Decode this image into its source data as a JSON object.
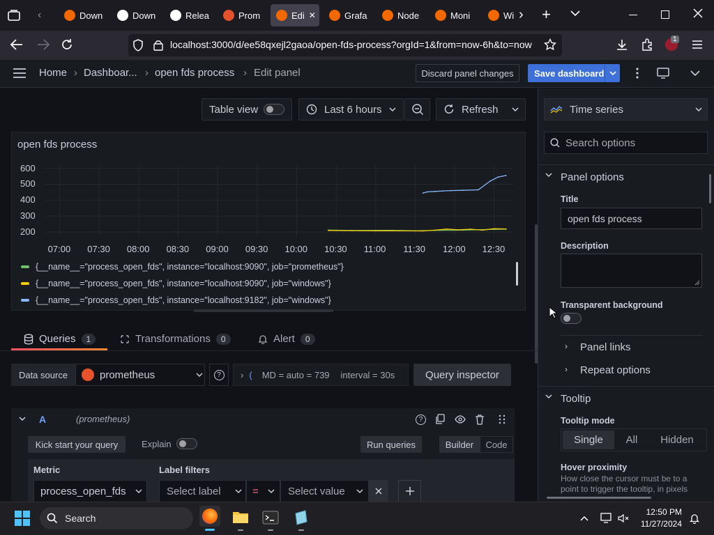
{
  "browser": {
    "tabs": [
      {
        "label": "Down",
        "icon": "grafana-icon"
      },
      {
        "label": "Down",
        "icon": "grafana-white-icon"
      },
      {
        "label": "Relea",
        "icon": "github-icon"
      },
      {
        "label": "Prom",
        "icon": "prometheus-icon"
      },
      {
        "label": "Edi",
        "icon": "grafana-icon",
        "active": true
      },
      {
        "label": "Grafa",
        "icon": "grafana-icon"
      },
      {
        "label": "Node",
        "icon": "grafana-icon"
      },
      {
        "label": "Moni",
        "icon": "grafana-icon"
      },
      {
        "label": "Wi",
        "icon": "grafana-icon"
      }
    ],
    "url": "localhost:3000/d/ee58qxejl2gaoa/open-fds-process?orgId=1&from=now-6h&to=now",
    "extension_badge": "1"
  },
  "header": {
    "breadcrumbs": [
      "Home",
      "Dashboar...",
      "open fds process",
      "Edit panel"
    ],
    "discard_label": "Discard panel changes",
    "save_label": "Save dashboard"
  },
  "toolbar": {
    "table_view_label": "Table view",
    "time_range_label": "Last 6 hours",
    "refresh_label": "Refresh"
  },
  "panel": {
    "title": "open fds process"
  },
  "chart_data": {
    "type": "line",
    "title": "open fds process",
    "xlabel": "",
    "ylabel": "",
    "x_ticks": [
      "07:00",
      "07:30",
      "08:00",
      "08:30",
      "09:00",
      "09:30",
      "10:00",
      "10:30",
      "11:00",
      "11:30",
      "12:00",
      "12:30"
    ],
    "y_ticks": [
      600,
      500,
      400,
      300,
      200
    ],
    "ylim": [
      170,
      620
    ],
    "grid": true,
    "legend_placement": "bottom",
    "series": [
      {
        "name": "{__name__=\"process_open_fds\", instance=\"localhost:9090\", job=\"prometheus\"}",
        "color": "#73bf69",
        "points": [
          [
            10.4,
            212
          ],
          [
            10.8,
            210
          ],
          [
            11.2,
            211
          ],
          [
            11.5,
            208
          ],
          [
            11.8,
            211
          ],
          [
            12.1,
            212
          ],
          [
            12.4,
            216
          ],
          [
            12.65,
            218
          ]
        ]
      },
      {
        "name": "{__name__=\"process_open_fds\", instance=\"localhost:9090\", job=\"windows\"}",
        "color": "#f2cc0c",
        "points": [
          [
            10.4,
            210
          ],
          [
            10.7,
            209
          ],
          [
            11.0,
            208
          ],
          [
            11.3,
            208
          ],
          [
            11.6,
            207
          ],
          [
            11.75,
            212
          ],
          [
            11.9,
            219
          ],
          [
            12.05,
            214
          ],
          [
            12.2,
            218
          ],
          [
            12.35,
            212
          ],
          [
            12.5,
            221
          ],
          [
            12.65,
            220
          ]
        ]
      },
      {
        "name": "{__name__=\"process_open_fds\", instance=\"localhost:9182\", job=\"windows\"}",
        "color": "#8ab8ff",
        "points": [
          [
            11.6,
            445
          ],
          [
            11.65,
            452
          ],
          [
            11.75,
            455
          ],
          [
            11.85,
            458
          ],
          [
            11.95,
            460
          ],
          [
            12.1,
            462
          ],
          [
            12.3,
            465
          ],
          [
            12.45,
            520
          ],
          [
            12.55,
            545
          ],
          [
            12.65,
            555
          ]
        ]
      }
    ]
  },
  "queries": {
    "tabs": [
      {
        "label": "Queries",
        "count": "1"
      },
      {
        "label": "Transformations",
        "count": "0"
      },
      {
        "label": "Alert",
        "count": "0"
      }
    ],
    "data_source_label": "Data source",
    "data_source_value": "prometheus",
    "query_options_text": "MD = auto = 739",
    "interval_text": "interval = 30s",
    "query_inspector_label": "Query inspector",
    "query_letter": "A",
    "query_ds_hint": "(prometheus)",
    "kick_start_label": "Kick start your query",
    "explain_label": "Explain",
    "run_queries_label": "Run queries",
    "builder_label": "Builder",
    "code_label": "Code",
    "metric_label": "Metric",
    "metric_value": "process_open_fds",
    "label_filters_label": "Label filters",
    "select_label_placeholder": "Select label",
    "operator_value": "=",
    "select_value_placeholder": "Select value"
  },
  "options": {
    "visualization": "Time series",
    "search_placeholder": "Search options",
    "panel_options_title": "Panel options",
    "title_label": "Title",
    "title_value": "open fds process",
    "description_label": "Description",
    "transparent_label": "Transparent background",
    "panel_links_label": "Panel links",
    "repeat_options_label": "Repeat options",
    "tooltip_title": "Tooltip",
    "tooltip_mode_label": "Tooltip mode",
    "tooltip_modes": [
      "Single",
      "All",
      "Hidden"
    ],
    "hover_proximity_label": "Hover proximity",
    "hover_proximity_desc": "How close the cursor must be to a point to trigger the tooltip, in pixels"
  },
  "taskbar": {
    "search_label": "Search",
    "time": "12:50 PM",
    "date": "11/27/2024"
  }
}
